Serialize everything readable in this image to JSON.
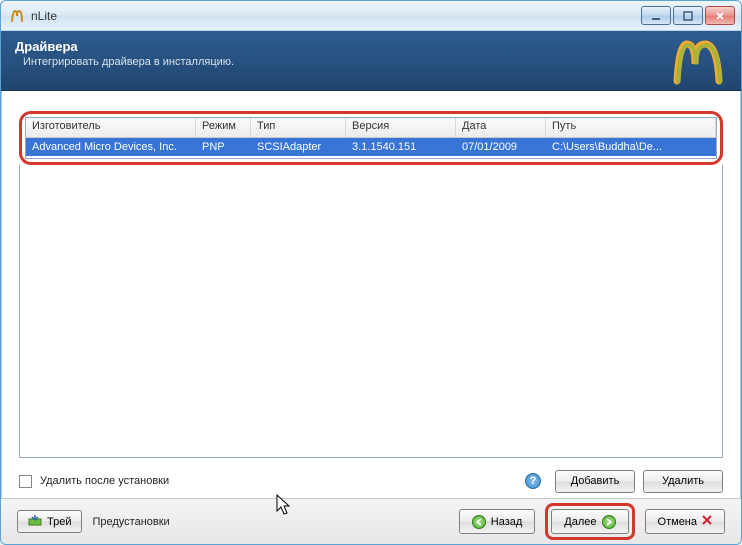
{
  "window": {
    "title": "nLite"
  },
  "banner": {
    "title": "Драйвера",
    "subtitle": "Интегрировать драйвера в инсталляцию."
  },
  "table": {
    "headers": {
      "maker": "Изготовитель",
      "mode": "Режим",
      "type": "Тип",
      "version": "Версия",
      "date": "Дата",
      "path": "Путь"
    },
    "rows": [
      {
        "maker": "Advanced Micro Devices, Inc.",
        "mode": "PNP",
        "type": "SCSIAdapter",
        "version": "3.1.1540.151",
        "date": "07/01/2009",
        "path": "C:\\Users\\Buddha\\De..."
      }
    ]
  },
  "options": {
    "delete_after_install": "Удалить после установки",
    "add": "Добавить",
    "remove": "Удалить"
  },
  "footer": {
    "tray": "Трей",
    "presets": "Предустановки",
    "back": "Назад",
    "next": "Далее",
    "cancel": "Отмена"
  },
  "chart_data": {
    "type": "table",
    "columns": [
      "Изготовитель",
      "Режим",
      "Тип",
      "Версия",
      "Дата",
      "Путь"
    ],
    "rows": [
      [
        "Advanced Micro Devices, Inc.",
        "PNP",
        "SCSIAdapter",
        "3.1.1540.151",
        "07/01/2009",
        "C:\\Users\\Buddha\\De..."
      ]
    ]
  }
}
